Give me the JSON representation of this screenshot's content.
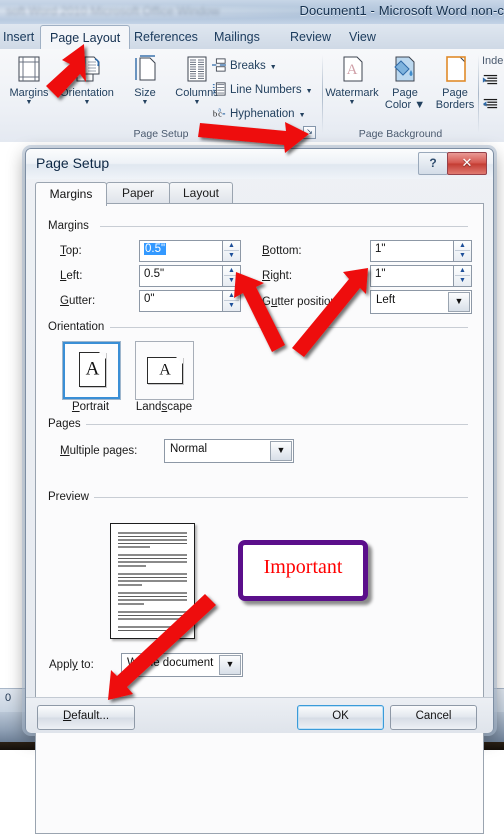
{
  "window": {
    "title": "Document1 - Microsoft Word non-c",
    "ghost_title": "soft Word 2010   Microsoft Office Window"
  },
  "ribbon": {
    "tabs": [
      {
        "label": "Insert",
        "active": false
      },
      {
        "label": "Page Layout",
        "active": true
      },
      {
        "label": "References",
        "active": false
      },
      {
        "label": "Mailings",
        "active": false
      },
      {
        "label": "Review",
        "active": false
      },
      {
        "label": "View",
        "active": false
      }
    ],
    "groups": [
      {
        "name": "Page Setup",
        "label": "Page Setup",
        "big_buttons": [
          {
            "label": "Margins",
            "icon": "margins-icon",
            "has_dropdown": true
          },
          {
            "label": "Orientation",
            "icon": "orientation-icon",
            "has_dropdown": true
          },
          {
            "label": "Size",
            "icon": "size-icon",
            "has_dropdown": true
          },
          {
            "label": "Columns",
            "icon": "columns-icon",
            "has_dropdown": true
          }
        ],
        "small_buttons": [
          {
            "label": "Breaks",
            "icon": "breaks-icon",
            "has_dropdown": true
          },
          {
            "label": "Line Numbers",
            "icon": "line-numbers-icon",
            "has_dropdown": true
          },
          {
            "label": "Hyphenation",
            "icon": "hyphenation-icon",
            "has_dropdown": true
          }
        ],
        "launcher_glyph": "↘"
      },
      {
        "name": "Page Background",
        "label": "Page Background",
        "big_buttons": [
          {
            "label": "Watermark",
            "icon": "watermark-icon",
            "has_dropdown": true
          },
          {
            "label": "Page Color",
            "icon": "page-color-icon",
            "has_dropdown": true
          },
          {
            "label": "Page Borders",
            "icon": "page-borders-icon",
            "has_dropdown": false
          }
        ]
      },
      {
        "name": "Paragraph",
        "label": "Inde",
        "small_buttons": [
          {
            "label": "",
            "icon": "indent-left-icon"
          },
          {
            "label": "",
            "icon": "indent-right-icon"
          }
        ]
      }
    ]
  },
  "status_bar": {
    "word_count": "0"
  },
  "dialog": {
    "title": "Page Setup",
    "help_glyph": "?",
    "close_glyph": "✕",
    "tabs": [
      {
        "label": "Margins",
        "active": true
      },
      {
        "label": "Paper",
        "active": false
      },
      {
        "label": "Layout",
        "active": false
      }
    ],
    "margins_section": {
      "title": "Margins",
      "fields": [
        {
          "label": "Top:",
          "accel": "T",
          "value": "0.5\"",
          "selected": true,
          "name": "top-margin"
        },
        {
          "label": "Left:",
          "accel": "L",
          "value": "0.5\"",
          "selected": false,
          "name": "left-margin"
        },
        {
          "label": "Gutter:",
          "accel": "G",
          "value": "0\"",
          "selected": false,
          "name": "gutter"
        },
        {
          "label": "Bottom:",
          "accel": "B",
          "value": "1\"",
          "selected": false,
          "name": "bottom-margin"
        },
        {
          "label": "Right:",
          "accel": "R",
          "value": "1\"",
          "selected": false,
          "name": "right-margin"
        }
      ],
      "gutter_position": {
        "label": "Gutter position:",
        "accel": "G",
        "value": "Left"
      }
    },
    "orientation_section": {
      "title": "Orientation",
      "options": [
        {
          "label": "Portrait",
          "accel": "P",
          "selected": true
        },
        {
          "label": "Landscape",
          "accel": "s",
          "selected": false
        }
      ]
    },
    "pages_section": {
      "title": "Pages",
      "multiple_pages": {
        "label": "Multiple pages:",
        "accel": "M",
        "value": "Normal"
      }
    },
    "preview_section": {
      "title": "Preview"
    },
    "apply_to": {
      "label": "Apply to:",
      "accel": "y",
      "value": "Whole document"
    },
    "buttons": [
      {
        "label": "Default...",
        "name": "default-button",
        "is_default": false
      },
      {
        "label": "OK",
        "name": "ok-button",
        "is_default": true
      },
      {
        "label": "Cancel",
        "name": "cancel-button",
        "is_default": false
      }
    ]
  },
  "annotations": {
    "important_label": "Important",
    "arrow_color": "#ee1111",
    "box_border_color": "#5b0f8b",
    "box_text_color": "#ff0000",
    "arrows": [
      {
        "name": "arrow-to-page-layout-tab"
      },
      {
        "name": "arrow-to-page-setup-launcher"
      },
      {
        "name": "arrow-to-left-margin"
      },
      {
        "name": "arrow-to-right-margin"
      },
      {
        "name": "arrow-to-default-button"
      }
    ]
  }
}
